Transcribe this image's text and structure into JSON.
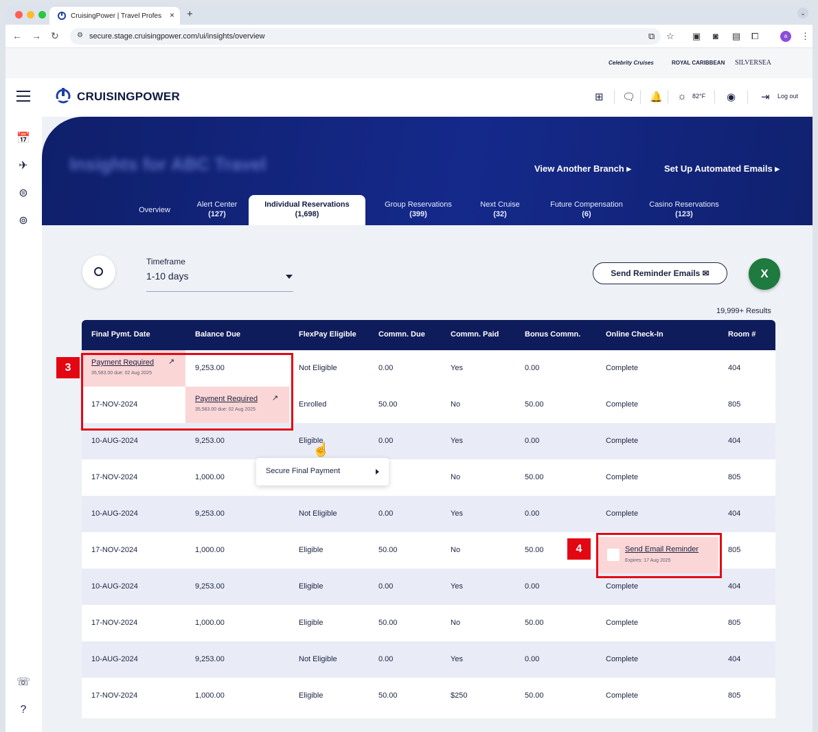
{
  "browser": {
    "tab_title": "CruisingPower | Travel Profes",
    "tab_close": "×",
    "new_tab": "+",
    "url": "secure.stage.cruisingpower.com/ui/insights/overview"
  },
  "brands": [
    "Celebrity Cruises",
    "ROYAL CARIBBEAN",
    "SILVERSEA"
  ],
  "app": {
    "logo": "CRUISINGPOWER",
    "weather": "82°F",
    "logout": "Log out"
  },
  "hero": {
    "title": "Insights for ABC Travel",
    "link_branch": "View Another Branch ▸",
    "link_emails": "Set Up Automated Emails ▸"
  },
  "tabs": [
    {
      "label": "Overview",
      "count": ""
    },
    {
      "label": "Alert Center",
      "count": "(127)"
    },
    {
      "label": "Individual Reservations",
      "count": "(1,698)"
    },
    {
      "label": "Group Reservations",
      "count": "(399)"
    },
    {
      "label": "Next Cruise",
      "count": "(32)"
    },
    {
      "label": "Future Compensation",
      "count": "(6)"
    },
    {
      "label": "Casino Reservations",
      "count": "(123)"
    }
  ],
  "filters": {
    "timeframe_label": "Timeframe",
    "timeframe_value": "1-10 days",
    "reminder_button": "Send Reminder Emails ✉",
    "excel_label": "X",
    "results": "19,999+ Results"
  },
  "table": {
    "headers": [
      "Final Pymt. Date",
      "Balance Due",
      "FlexPay Eligible",
      "Commn. Due",
      "Commn. Paid",
      "Bonus Commn.",
      "Online Check-In",
      "Room #"
    ],
    "rows": [
      [
        "",
        "9,253.00",
        "Not Eligible",
        "0.00",
        "Yes",
        "0.00",
        "Complete",
        "404"
      ],
      [
        "17-NOV-2024",
        "",
        "Enrolled",
        "50.00",
        "No",
        "50.00",
        "Complete",
        "805"
      ],
      [
        "10-AUG-2024",
        "9,253.00",
        "Eligible",
        "0.00",
        "Yes",
        "0.00",
        "Complete",
        "404"
      ],
      [
        "17-NOV-2024",
        "1,000.00",
        "",
        "",
        "No",
        "50.00",
        "Complete",
        "805"
      ],
      [
        "10-AUG-2024",
        "9,253.00",
        "Not Eligible",
        "0.00",
        "Yes",
        "0.00",
        "Complete",
        "404"
      ],
      [
        "17-NOV-2024",
        "1,000.00",
        "Eligible",
        "50.00",
        "No",
        "50.00",
        "",
        "805"
      ],
      [
        "10-AUG-2024",
        "9,253.00",
        "Eligible",
        "0.00",
        "Yes",
        "0.00",
        "Complete",
        "404"
      ],
      [
        "17-NOV-2024",
        "1,000.00",
        "Eligible",
        "50.00",
        "No",
        "50.00",
        "Complete",
        "805"
      ],
      [
        "10-AUG-2024",
        "9,253.00",
        "Not Eligible",
        "0.00",
        "Yes",
        "0.00",
        "Complete",
        "404"
      ],
      [
        "17-NOV-2024",
        "1,000.00",
        "Eligible",
        "50.00",
        "$250",
        "50.00",
        "Complete",
        "805"
      ]
    ],
    "payment_required": "Payment Required",
    "payment_sub": "35,583.00 due: 02 Aug 2025",
    "popup_action": "Secure Final Payment",
    "email_reminder": "Send Email Reminder",
    "email_sub": "Expires: 17 Aug 2025"
  },
  "annotations": {
    "badge_3": "3",
    "badge_4": "4"
  },
  "colors": {
    "navy": "#0f1c5b",
    "highlight": "#fbd6d6",
    "annotation": "#e30613",
    "excel": "#1e7a3e"
  }
}
